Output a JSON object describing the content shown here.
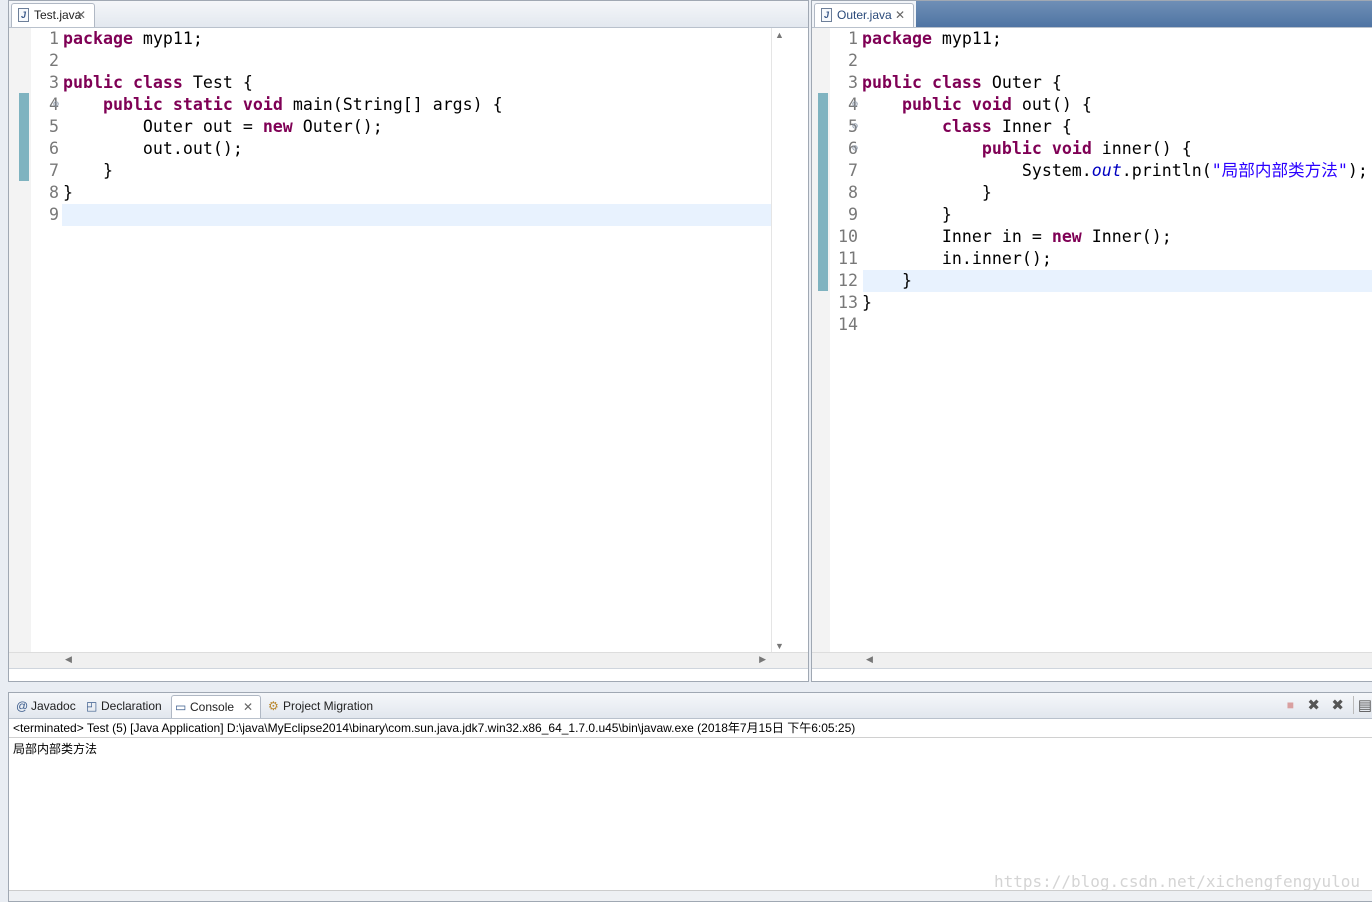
{
  "left_editor": {
    "tab_title": "Test.java",
    "tab_close": "✕",
    "lines": [
      {
        "n": "1",
        "html": "<span class=\"kw\">package</span> myp11;"
      },
      {
        "n": "2",
        "html": ""
      },
      {
        "n": "3",
        "html": "<span class=\"kw\">public</span> <span class=\"kw\">class</span> Test {"
      },
      {
        "n": "4",
        "html": "    <span class=\"kw\">public</span> <span class=\"kw\">static</span> <span class=\"kw\">void</span> main(String[] args) {",
        "fold": true
      },
      {
        "n": "5",
        "html": "        Outer out = <span class=\"kw\">new</span> Outer();"
      },
      {
        "n": "6",
        "html": "        out.out();"
      },
      {
        "n": "7",
        "html": "    }"
      },
      {
        "n": "8",
        "html": "}"
      },
      {
        "n": "9",
        "html": ""
      }
    ]
  },
  "right_editor": {
    "tab_title": "Outer.java",
    "tab_close": "✕",
    "lines": [
      {
        "n": "1",
        "html": "<span class=\"kw\">package</span> myp11;"
      },
      {
        "n": "2",
        "html": ""
      },
      {
        "n": "3",
        "html": "<span class=\"kw\">public</span> <span class=\"kw\">class</span> Outer {"
      },
      {
        "n": "4",
        "html": "    <span class=\"kw\">public</span> <span class=\"kw\">void</span> out() {",
        "fold": true
      },
      {
        "n": "5",
        "html": "        <span class=\"kw\">class</span> Inner {",
        "fold": true
      },
      {
        "n": "6",
        "html": "            <span class=\"kw\">public</span> <span class=\"kw\">void</span> inner() {",
        "fold": true
      },
      {
        "n": "7",
        "html": "                System.<span class=\"fld\">out</span>.println(<span class=\"str\">\"局部内部类方法\"</span>);"
      },
      {
        "n": "8",
        "html": "            }"
      },
      {
        "n": "9",
        "html": "        }"
      },
      {
        "n": "10",
        "html": "        Inner in = <span class=\"kw\">new</span> Inner();"
      },
      {
        "n": "11",
        "html": "        in.inner();"
      },
      {
        "n": "12",
        "html": "    }"
      },
      {
        "n": "13",
        "html": "}"
      },
      {
        "n": "14",
        "html": ""
      }
    ]
  },
  "console": {
    "tabs": [
      {
        "label": "Javadoc",
        "icon": "@"
      },
      {
        "label": "Declaration",
        "icon": "◰"
      },
      {
        "label": "Console",
        "icon": "▭",
        "active": true,
        "close": "✕"
      },
      {
        "label": "Project Migration",
        "icon": "⚙"
      }
    ],
    "status": "<terminated> Test (5) [Java Application] D:\\java\\MyEclipse2014\\binary\\com.sun.java.jdk7.win32.x86_64_1.7.0.u45\\bin\\javaw.exe (2018年7月15日 下午6:05:25)",
    "output": "局部内部类方法",
    "watermark": "https://blog.csdn.net/xichengfengyulou"
  },
  "colors": {
    "keyword": "#7f0055",
    "string": "#2a00ff",
    "static_field": "#0000c0",
    "current_line": "#e8f2fe",
    "change_bar": "#7fb3c0"
  }
}
